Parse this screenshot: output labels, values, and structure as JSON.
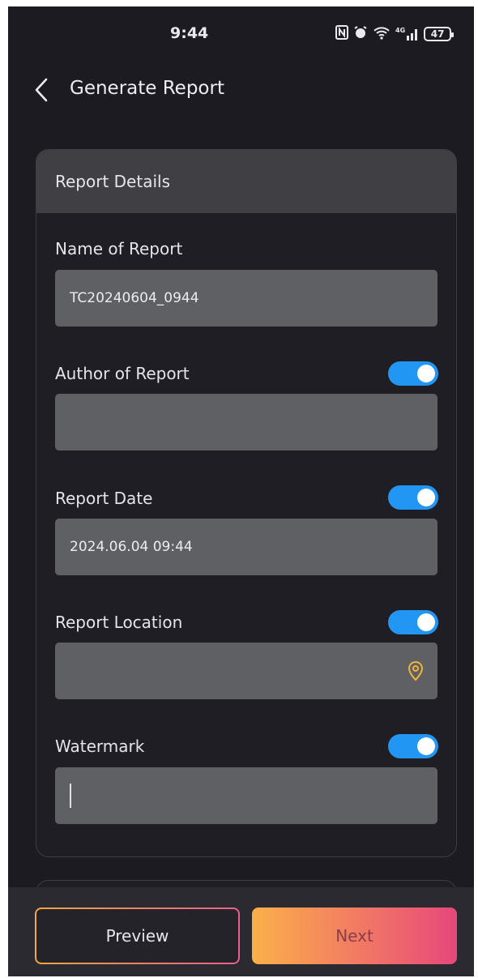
{
  "status_bar": {
    "time": "9:44",
    "battery": "47",
    "signal_label": "4G"
  },
  "header": {
    "title": "Generate Report",
    "back_icon": "chevron-left-icon"
  },
  "report_details": {
    "section_title": "Report Details",
    "name": {
      "label": "Name of Report",
      "value": "TC20240604_0944"
    },
    "author": {
      "label": "Author of Report",
      "value": "",
      "enabled": true
    },
    "date": {
      "label": "Report Date",
      "value": "2024.06.04 09:44",
      "enabled": true
    },
    "location": {
      "label": "Report Location",
      "value": "",
      "enabled": true,
      "icon": "location-pin-icon"
    },
    "watermark": {
      "label": "Watermark",
      "value": "",
      "enabled": true
    }
  },
  "actions": {
    "preview_label": "Preview",
    "next_label": "Next"
  },
  "colors": {
    "toggle_on": "#2196f3",
    "accent_orange": "#f5a742",
    "accent_pink": "#ea5f8a",
    "location_icon": "#f0b43c"
  }
}
